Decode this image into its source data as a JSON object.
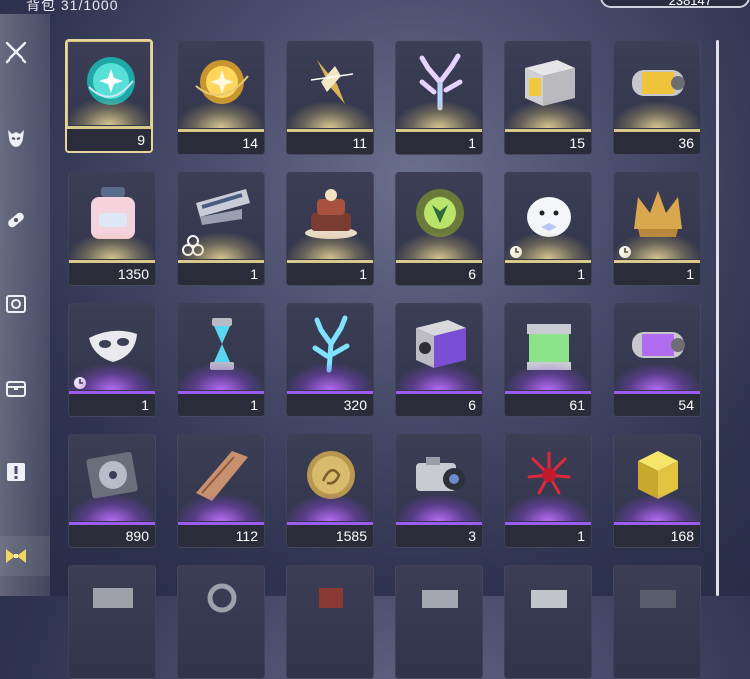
{
  "header": {
    "title": "背包 31/1000",
    "currency": "238147"
  },
  "sidebar": {
    "items": [
      {
        "name": "weapon",
        "icon": "crossed-swords-icon"
      },
      {
        "name": "echo",
        "icon": "demon-mask-icon"
      },
      {
        "name": "upgrade",
        "icon": "bandage-icon"
      },
      {
        "name": "develop",
        "icon": "gear-card-icon"
      },
      {
        "name": "resources",
        "icon": "chest-icon"
      },
      {
        "name": "quest",
        "icon": "exclamation-card-icon"
      },
      {
        "name": "special",
        "icon": "bow-tie-icon",
        "active": true
      }
    ]
  },
  "inventory": [
    [
      {
        "item": "teal-orb",
        "count": "9",
        "rarity": "gold",
        "selected": true
      },
      {
        "item": "gold-orb",
        "count": "14",
        "rarity": "gold"
      },
      {
        "item": "crystal-shard",
        "count": "11",
        "rarity": "gold"
      },
      {
        "item": "iridescent-coral",
        "count": "1",
        "rarity": "gold"
      },
      {
        "item": "gold-chest-box",
        "count": "15",
        "rarity": "gold"
      },
      {
        "item": "gold-capsule",
        "count": "36",
        "rarity": "gold"
      }
    ],
    [
      {
        "item": "pink-jar",
        "count": "1350",
        "rarity": "gold"
      },
      {
        "item": "weapon-card",
        "count": "1",
        "rarity": "gold",
        "badge": "trefoil"
      },
      {
        "item": "layer-cake",
        "count": "1",
        "rarity": "gold"
      },
      {
        "item": "green-emblem",
        "count": "6",
        "rarity": "gold"
      },
      {
        "item": "seal-plush",
        "count": "1",
        "rarity": "gold",
        "badge": "clock"
      },
      {
        "item": "gold-crown",
        "count": "1",
        "rarity": "gold",
        "badge": "clock"
      }
    ],
    [
      {
        "item": "white-mask",
        "count": "1",
        "rarity": "purple",
        "badge": "clock"
      },
      {
        "item": "blue-hourglass",
        "count": "1",
        "rarity": "purple"
      },
      {
        "item": "blue-coral",
        "count": "320",
        "rarity": "purple"
      },
      {
        "item": "purple-chest-box",
        "count": "6",
        "rarity": "purple"
      },
      {
        "item": "green-tank",
        "count": "61",
        "rarity": "purple"
      },
      {
        "item": "purple-capsule",
        "count": "54",
        "rarity": "purple"
      }
    ],
    [
      {
        "item": "disc-case",
        "count": "890",
        "rarity": "purple"
      },
      {
        "item": "bronze-bar",
        "count": "112",
        "rarity": "purple"
      },
      {
        "item": "gold-coin",
        "count": "1585",
        "rarity": "purple"
      },
      {
        "item": "camera",
        "count": "3",
        "rarity": "purple"
      },
      {
        "item": "red-flower",
        "count": "1",
        "rarity": "purple"
      },
      {
        "item": "glowing-cube",
        "count": "168",
        "rarity": "purple"
      }
    ]
  ]
}
